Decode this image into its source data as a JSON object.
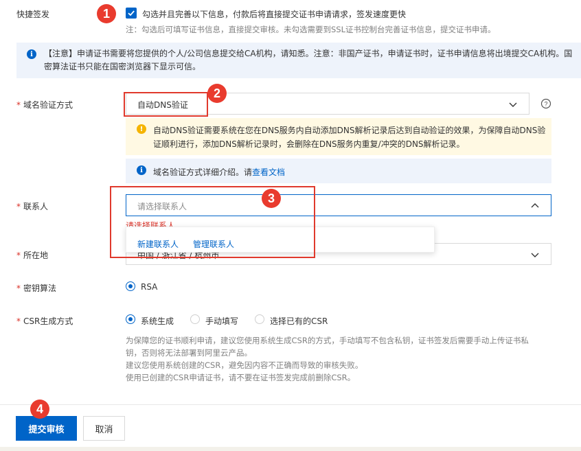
{
  "quick_issue": {
    "label": "快捷签发",
    "checkbox_text": "勾选并且完善以下信息，付款后将直接提交证书申请请求，签发速度更快",
    "note": "注：勾选后可填写证书信息，直接提交审核。未勾选需要到SSL证书控制台完善证书信息，提交证书申请。"
  },
  "notice": {
    "text_line1": "【注意】申请证书需要将您提供的个人/公司信息提交给CA机构，请知悉。注意：非国产证书，申请证书时，证书申请信息将出境提交CA机构。国",
    "text_line2": "密算法证书只能在国密浏览器下显示可信。"
  },
  "domain_verify": {
    "label": "域名验证方式",
    "value": "自动DNS验证",
    "warning_line1": "自动DNS验证需要系统在您在DNS服务内自动添加DNS解析记录后达到自动验证的效果，为保障自动DNS验",
    "warning_line2": "证顺利进行，添加DNS解析记录时，会删除在DNS服务内重复/冲突的DNS解析记录。",
    "info_text": "域名验证方式详细介绍。请",
    "info_link": "查看文档"
  },
  "contact": {
    "label": "联系人",
    "placeholder": "请选择联系人",
    "error": "请选择联系人",
    "dropdown_new": "新建联系人",
    "dropdown_manage": "管理联系人"
  },
  "location": {
    "label": "所在地",
    "value": "中国 / 浙江省 / 杭州市"
  },
  "key_algo": {
    "label": "密钥算法",
    "option": "RSA"
  },
  "csr": {
    "label": "CSR生成方式",
    "options": [
      "系统生成",
      "手动填写",
      "选择已有的CSR"
    ],
    "help_line1": "为保障您的证书顺利申请，建议您使用系统生成CSR的方式，手动填写不包含私钥，证书签发后需要手动上传证书私",
    "help_line2": "钥，否则将无法部署到阿里云产品。",
    "help_line3": "建议您使用系统创建的CSR，避免因内容不正确而导致的审核失败。",
    "help_line4": "使用已创建的CSR申请证书，请不要在证书签发完成前删除CSR。"
  },
  "footer": {
    "submit": "提交审核",
    "cancel": "取消"
  },
  "callouts": [
    "1",
    "2",
    "3",
    "4"
  ],
  "colors": {
    "primary": "#0064c8",
    "callout": "#e93b2e",
    "error": "#d93026",
    "warning_bg": "#fff9e3",
    "info_bg": "#eef3fb"
  }
}
